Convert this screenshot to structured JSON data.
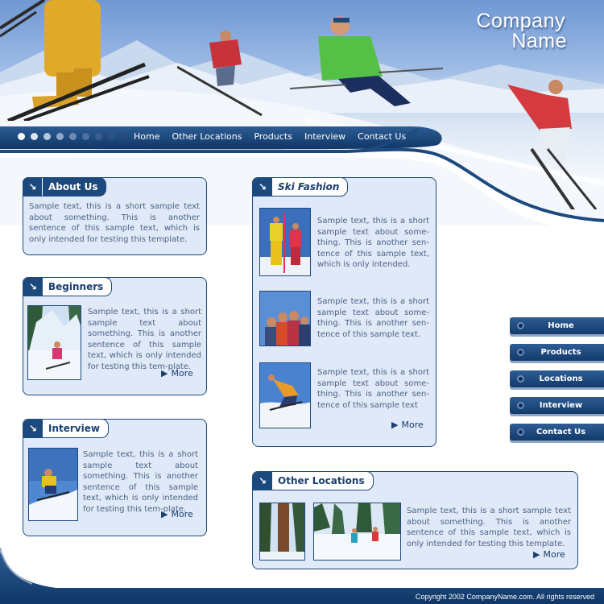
{
  "header": {
    "company_line1": "Company",
    "company_line2": "Name"
  },
  "top_nav": [
    "Home",
    "Other Locations",
    "Products",
    "Interview",
    "Contact Us"
  ],
  "boxes": {
    "about": {
      "title": "About Us",
      "text": "Sample text, this is a short sample text about something. This is another sentence of this sample text, which is only intended for testing this template."
    },
    "beginners": {
      "title": "Beginners",
      "text": "Sample text, this is a short sample text about something. This is another sentence of this sample text, which is only intended for testing this tem-plate.",
      "more": "More"
    },
    "interview": {
      "title": "Interview",
      "text": "Sample text, this is a short sample text about something. This is another sentence of this sample text, which is only intended for testing this tem-plate.",
      "more": "More"
    },
    "ski_fashion": {
      "title": "Ski Fashion",
      "items": [
        "Sample text, this is a short sample text about some-thing. This is another sen-tence of this sample text, which is only intended.",
        "Sample text, this is a short sample text about some-thing. This is another sen-tence of this sample text.",
        "Sample text, this is a short sample text about some-thing. This is another sen-tence of this sample text"
      ],
      "more": "More"
    },
    "other_locations": {
      "title": "Other Locations",
      "text": "Sample text, this is a short sample text about something. This is another sentence of this sample text, which is only intended for testing this template.",
      "more": "More"
    }
  },
  "side_menu": [
    "Home",
    "Products",
    "Locations",
    "Interview",
    "Contact Us"
  ],
  "footer": {
    "copyright": "Copyright 2002 CompanyName.com. All rights reserved"
  },
  "colors": {
    "navy": "#1d4a7e",
    "box_bg": "#dfe9f7",
    "text": "#4d6283"
  }
}
